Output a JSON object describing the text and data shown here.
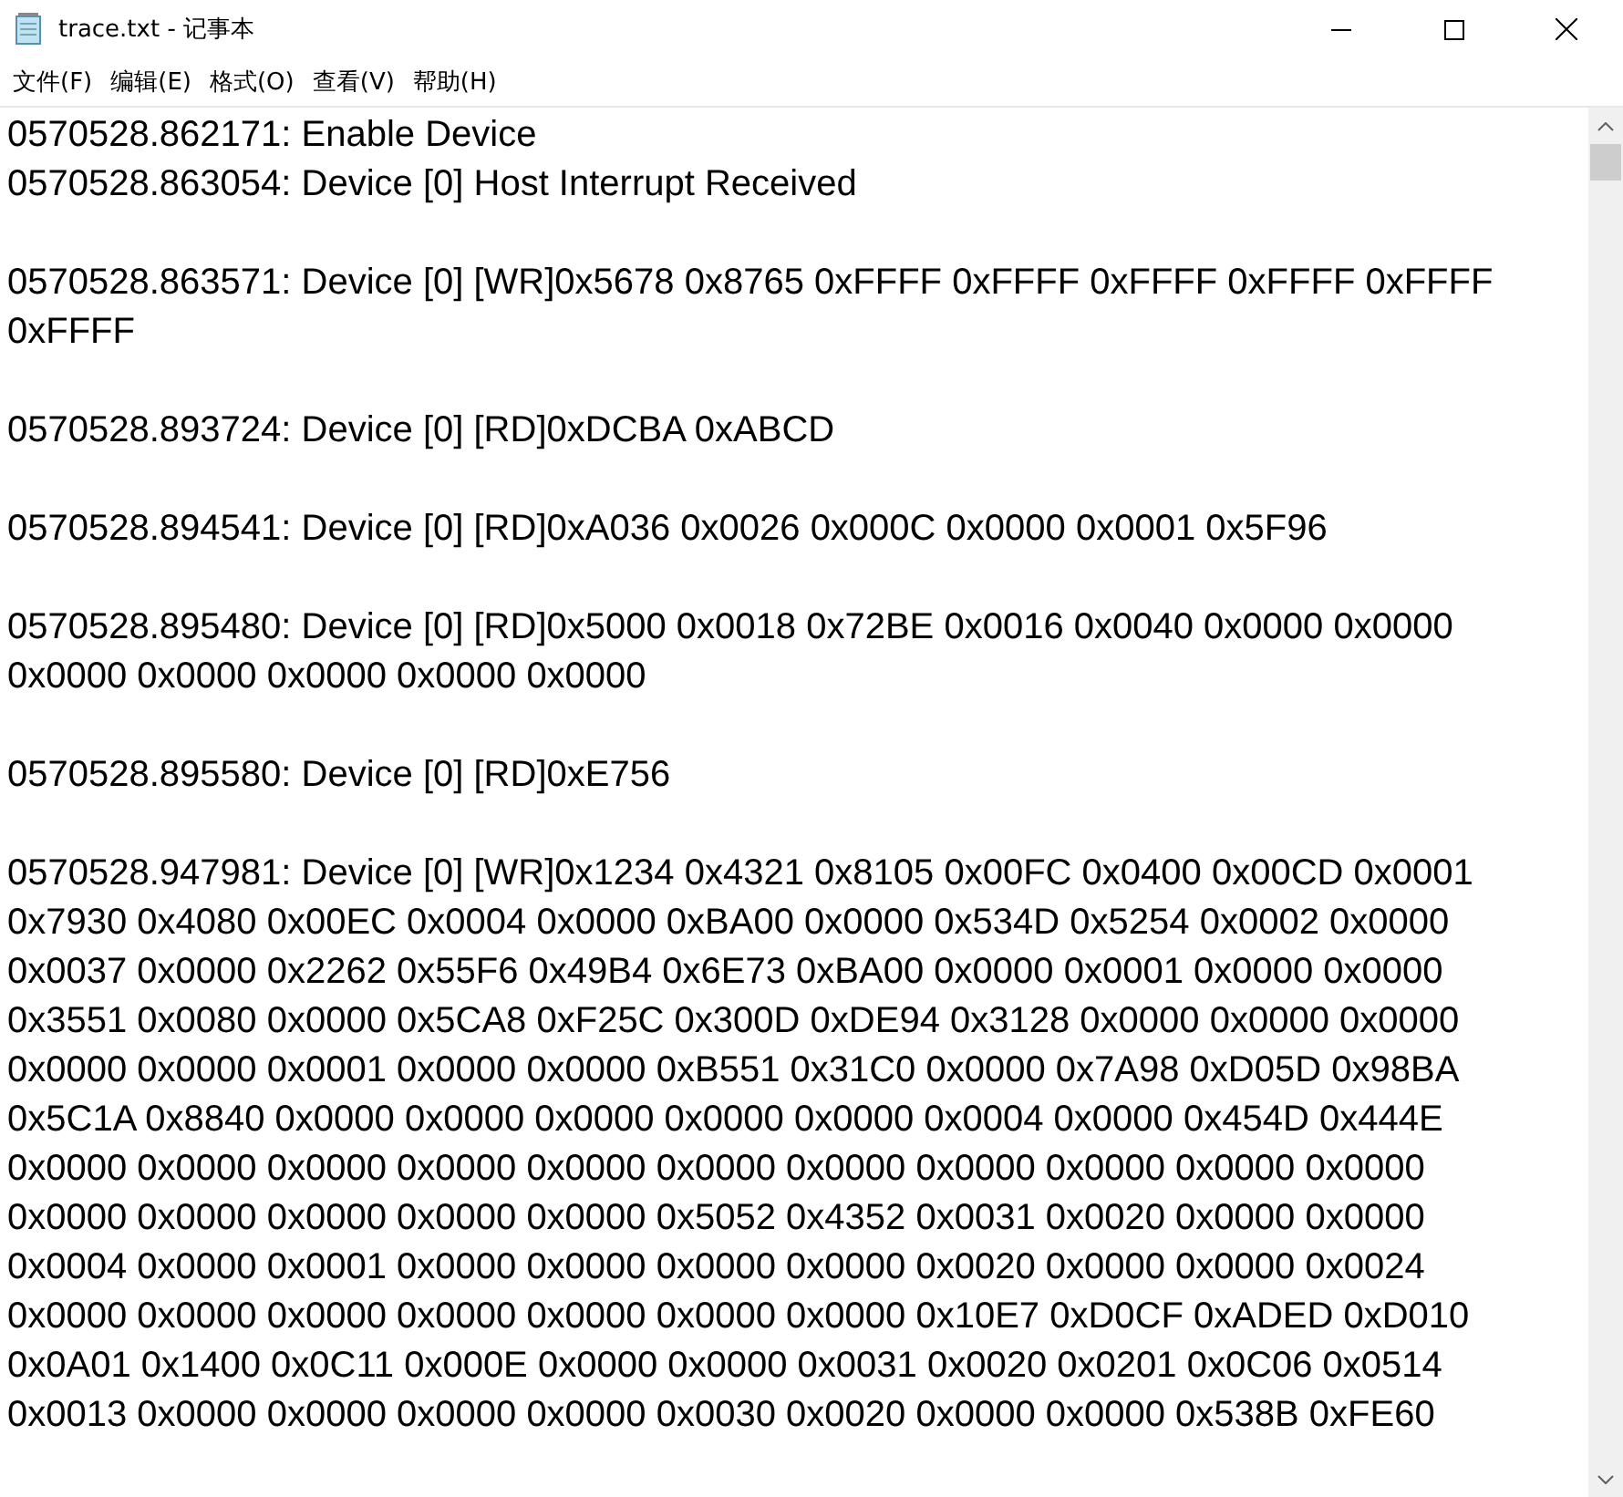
{
  "window": {
    "title": "trace.txt - 记事本"
  },
  "menu": [
    "文件(F)",
    "编辑(E)",
    "格式(O)",
    "查看(V)",
    "帮助(H)"
  ],
  "editor": {
    "blocks": [
      {
        "lines": [
          "0570528.862171: Enable Device",
          "0570528.863054: Device [0] Host Interrupt Received"
        ]
      },
      {
        "lines": [
          "0570528.863571: Device [0] [WR]0x5678 0x8765 0xFFFF 0xFFFF 0xFFFF 0xFFFF 0xFFFF",
          "0xFFFF"
        ]
      },
      {
        "lines": [
          "0570528.893724: Device [0] [RD]0xDCBA 0xABCD"
        ]
      },
      {
        "lines": [
          "0570528.894541: Device [0] [RD]0xA036 0x0026 0x000C 0x0000 0x0001 0x5F96"
        ]
      },
      {
        "lines": [
          "0570528.895480: Device [0] [RD]0x5000 0x0018 0x72BE 0x0016 0x0040 0x0000 0x0000",
          "0x0000 0x0000 0x0000 0x0000 0x0000"
        ]
      },
      {
        "lines": [
          "0570528.895580: Device [0] [RD]0xE756"
        ]
      },
      {
        "lines": [
          "0570528.947981: Device [0] [WR]0x1234 0x4321 0x8105 0x00FC 0x0400 0x00CD 0x0001",
          "0x7930 0x4080 0x00EC 0x0004 0x0000 0xBA00 0x0000 0x534D 0x5254 0x0002 0x0000",
          "0x0037 0x0000 0x2262 0x55F6 0x49B4 0x6E73 0xBA00 0x0000 0x0001 0x0000 0x0000",
          "0x3551 0x0080 0x0000 0x5CA8 0xF25C 0x300D 0xDE94 0x3128 0x0000 0x0000 0x0000",
          "0x0000 0x0000 0x0001 0x0000 0x0000 0xB551 0x31C0 0x0000 0x7A98 0xD05D 0x98BA",
          "0x5C1A 0x8840 0x0000 0x0000 0x0000 0x0000 0x0000 0x0004 0x0000 0x454D 0x444E",
          "0x0000 0x0000 0x0000 0x0000 0x0000 0x0000 0x0000 0x0000 0x0000 0x0000 0x0000",
          "0x0000 0x0000 0x0000 0x0000 0x0000 0x5052 0x4352 0x0031 0x0020 0x0000 0x0000",
          "0x0004 0x0000 0x0001 0x0000 0x0000 0x0000 0x0000 0x0020 0x0000 0x0000 0x0024",
          "0x0000 0x0000 0x0000 0x0000 0x0000 0x0000 0x0000 0x10E7 0xD0CF 0xADED 0xD010",
          "0x0A01 0x1400 0x0C11 0x000E 0x0000 0x0000 0x0031 0x0020 0x0201 0x0C06 0x0514",
          "0x0013 0x0000 0x0000 0x0000 0x0000 0x0030 0x0020 0x0000 0x0000 0x538B 0xFE60"
        ]
      }
    ]
  }
}
